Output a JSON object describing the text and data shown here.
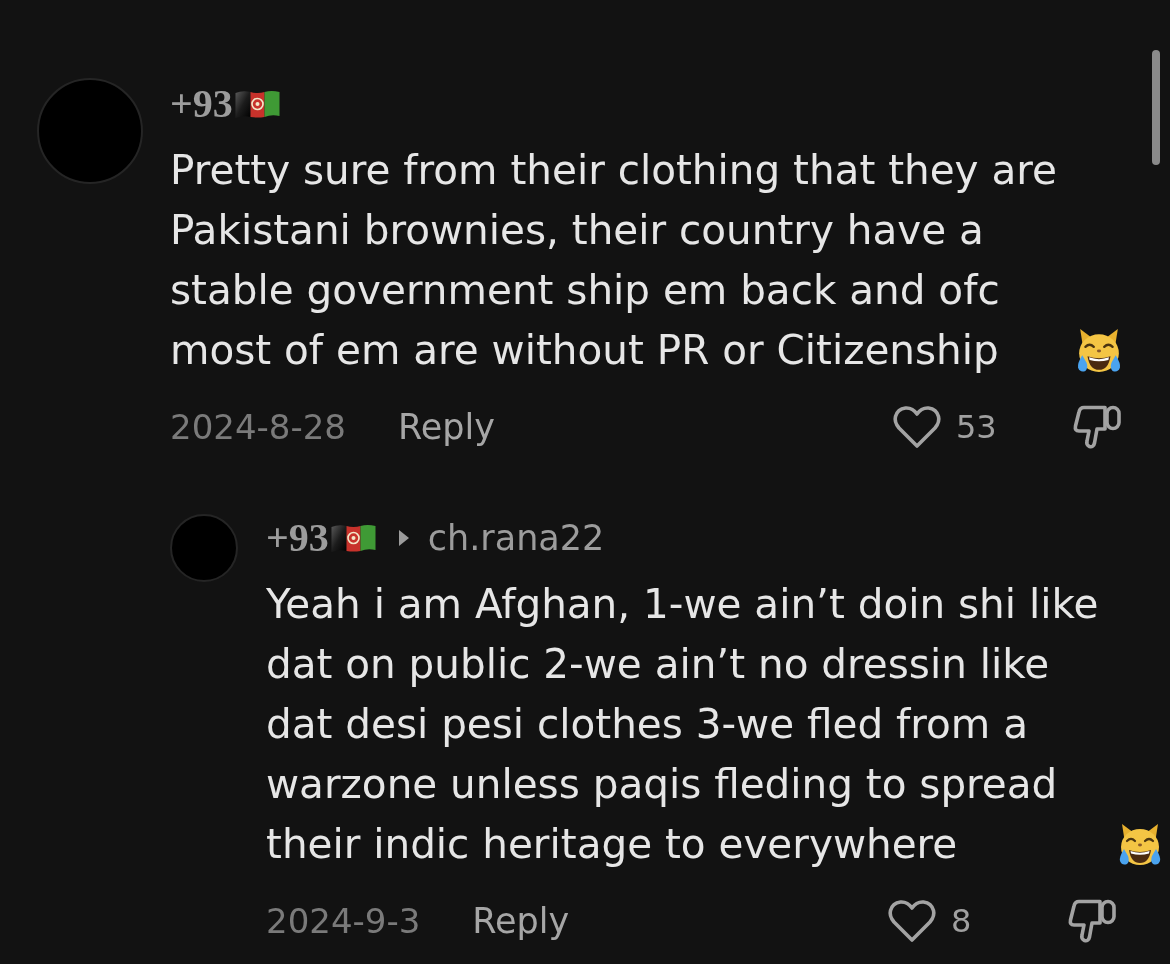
{
  "comments": [
    {
      "author": "+93",
      "text": "Pretty sure from their clothing that they are Pakistani brownies, their country have a stable government ship em back and ofc most of em are without PR or Citizenship",
      "date": "2024-8-28",
      "reply_label": "Reply",
      "like_count": "53",
      "liked": false,
      "disliked": false,
      "replies": [
        {
          "author": "+93",
          "reply_to": "ch.rana22",
          "text": "Yeah i am Afghan, 1-we ain’t doin shi like dat on public 2-we ain’t no dressin like dat desi pesi clothes 3-we fled from a warzone unless paqis fleding to spread their indic heritage to everywhere",
          "date": "2024-9-3",
          "reply_label": "Reply",
          "like_count": "8",
          "liked": false,
          "disliked": false
        }
      ]
    }
  ]
}
